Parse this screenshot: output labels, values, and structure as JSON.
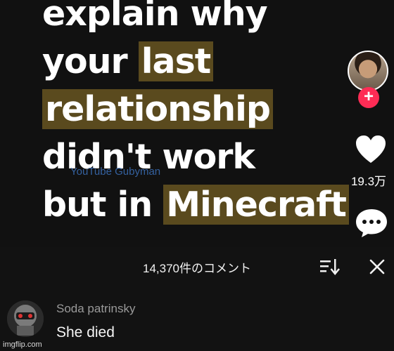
{
  "video": {
    "caption_lines": [
      [
        "explain why",
        ""
      ],
      [
        "your ",
        "last"
      ],
      [
        "",
        "relationship"
      ],
      [
        "didn't work",
        ""
      ],
      [
        "but in ",
        "Minecraft"
      ]
    ],
    "caption": {
      "l1": "explain why",
      "l2a": "your ",
      "l2b": "last",
      "l3": "relationship",
      "l4": "didn't work",
      "l5a": "but in ",
      "l5b": "Minecraft"
    },
    "watermark": "YouTube Gubyman",
    "highlight_color": "#5a4a1e"
  },
  "rail": {
    "follow_icon": "plus-icon",
    "like_icon": "heart-icon",
    "like_count": "19.3万",
    "comment_icon": "comment-bubble-icon",
    "follow_color": "#fe2c55"
  },
  "sheet": {
    "comment_count": "14,370件のコメント",
    "sort_icon": "sort-icon",
    "close_icon": "close-icon",
    "comments": [
      {
        "user": "Soda patrinsky",
        "text": "She died",
        "avatar_icon": "robot-helmet-avatar"
      }
    ]
  },
  "footer": {
    "watermark": "imgflip.com"
  }
}
